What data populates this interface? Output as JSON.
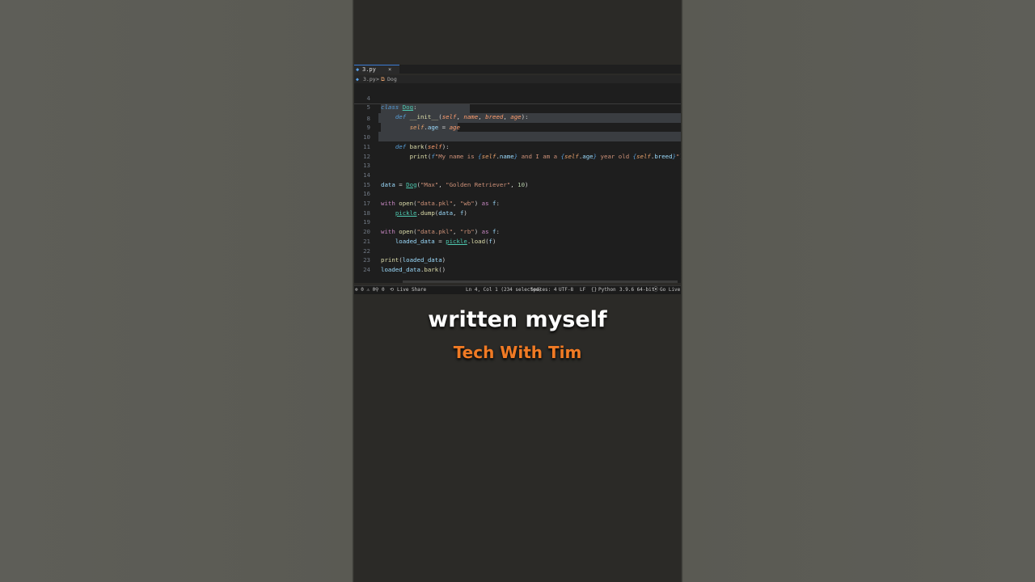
{
  "editor_tab": {
    "filename": "3.py",
    "close_glyph": "×"
  },
  "breadcrumb": {
    "file": "3.py",
    "separator": ">",
    "symbol": "Dog"
  },
  "code_lines": [
    {
      "num": "4",
      "text": "class Dog:"
    },
    {
      "num": "5",
      "text": "    def __init__(self, name, breed, age):"
    },
    {
      "num": "8",
      "text": "        self.age = age"
    },
    {
      "num": "9",
      "text": ""
    },
    {
      "num": "10",
      "text": "    def bark(self):"
    },
    {
      "num": "11",
      "text": "        print(f\"My name is {self.name} and I am a {self.age} year old {self.breed}\")"
    },
    {
      "num": "12",
      "text": ""
    },
    {
      "num": "13",
      "text": ""
    },
    {
      "num": "14",
      "text": "data = Dog(\"Max\", \"Golden Retriever\", 10)"
    },
    {
      "num": "15",
      "text": ""
    },
    {
      "num": "16",
      "text": "with open(\"data.pkl\", \"wb\") as f:"
    },
    {
      "num": "17",
      "text": "    pickle.dump(data, f)"
    },
    {
      "num": "18",
      "text": ""
    },
    {
      "num": "19",
      "text": "with open(\"data.pkl\", \"rb\") as f:"
    },
    {
      "num": "20",
      "text": "    loaded_data = pickle.load(f)"
    },
    {
      "num": "21",
      "text": ""
    },
    {
      "num": "22",
      "text": "print(loaded_data)"
    },
    {
      "num": "23",
      "text": "loaded_data.bark()"
    },
    {
      "num": "24",
      "text": ""
    }
  ],
  "status_bar": {
    "errors": "⊗ 0 ⚠ 0",
    "ports": "⚲ 0",
    "live_share": "Live Share",
    "cursor": "Ln 4, Col 1 (234 selected)",
    "spaces": "Spaces: 4",
    "encoding": "UTF-8",
    "eol": "LF",
    "language": "Python",
    "interpreter": "3.9.6 64-bit",
    "go_live": "Go Live"
  },
  "captions": {
    "subtitle": "written myself",
    "channel": "Tech With Tim"
  },
  "colors": {
    "accent_orange": "#f07a24",
    "editor_bg": "#1e1e1e",
    "selection": "#3a3d41"
  }
}
